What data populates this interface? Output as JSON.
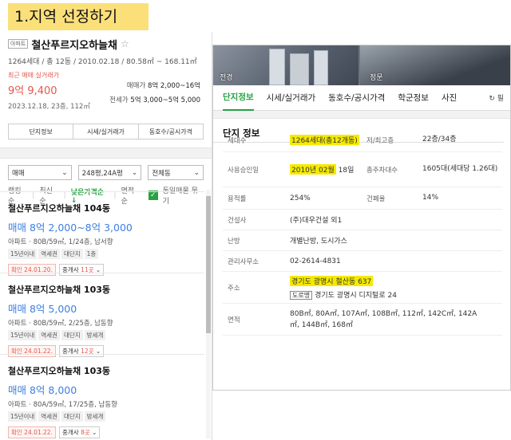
{
  "step_label": "1.지역 선정하기",
  "complex": {
    "badge": "아파트",
    "name": "철산푸르지오하늘채",
    "star": "☆",
    "meta": "1264세대 / 총 12동 / 2010.02.18 / 80.58㎡ ~ 168.11㎡",
    "recent_label": "최근 매매 실거래가",
    "recent_price": "9억 9,400",
    "recent_date": "2023.12.18, 23층, 112㎡",
    "sale_label": "매매가",
    "sale_range": "8억 2,000~16억",
    "jeonse_label": "전세가",
    "jeonse_range": "5억 3,000~5억 5,000"
  },
  "tab_buttons": [
    "단지정보",
    "시세/실거래가",
    "동호수/공시가격"
  ],
  "filters": {
    "deal": "매매",
    "area": "248평,24A평",
    "dong": "전체동"
  },
  "sort": {
    "options": [
      "랭킹순",
      "최신순",
      "낮은가격순↓",
      "면적순"
    ],
    "same_listing_label": "동일매물 묶기"
  },
  "listings": [
    {
      "name": "철산푸르지오하늘채 104동",
      "price": "매매 8억 2,000~8억 3,000",
      "spec": "아파트 · 80B/59㎡, 1/24층, 남서향",
      "tags": [
        "15년이내",
        "역세권",
        "대단지",
        "1층"
      ],
      "confirm": "확인 24.01.20.",
      "brokers_label": "중개사",
      "brokers_count": "11곳"
    },
    {
      "name": "철산푸르지오하늘채 103동",
      "price": "매매 8억 5,000",
      "spec": "아파트 · 80B/59㎡, 2/25층, 남동향",
      "tags": [
        "15년이내",
        "역세권",
        "대단지",
        "방세개"
      ],
      "confirm": "확인 24.01.22.",
      "brokers_label": "중개사",
      "brokers_count": "12곳"
    },
    {
      "name": "철산푸르지오하늘채 103동",
      "price": "매매 8억 8,000",
      "spec": "아파트 · 80A/59㎡, 17/25층, 남동향",
      "tags": [
        "15년이내",
        "역세권",
        "대단지",
        "방세개"
      ],
      "confirm": "확인 24.01.22.",
      "brokers_label": "중개사",
      "brokers_count": "8곳"
    }
  ],
  "photos": {
    "left_label": "전경",
    "right_label": "정문"
  },
  "right_tabs": [
    "단지정보",
    "시세/실거래가",
    "동호수/공시가격",
    "학군정보",
    "사진"
  ],
  "refresh_label": "↻ 필",
  "section_title": "단지 정보",
  "info": {
    "households_label": "세대수",
    "households_value": "1264세대(총12개동)",
    "floors_label": "저/최고층",
    "floors_value": "22층/34층",
    "approval_label": "사용승인일",
    "approval_value": "2010년 02월",
    "approval_day": "18일",
    "parking_label": "총주차대수",
    "parking_value": "1605대(세대당 1.26대)",
    "far_label": "용적률",
    "far_value": "254%",
    "bcr_label": "건폐율",
    "bcr_value": "14%",
    "builder_label": "건설사",
    "builder_value": "(주)대우건설 외1",
    "heating_label": "난방",
    "heating_value": "개별난방, 도시가스",
    "office_label": "관리사무소",
    "office_value": "02-2614-4831",
    "address_label": "주소",
    "address_value": "경기도 광명시 철산동 637",
    "road_badge": "도로명",
    "road_value": "경기도 광명시 디지털로 24",
    "area_label": "면적",
    "area_value": "80B㎡, 80A㎡, 107A㎡, 108B㎡, 112㎡, 142C㎡, 142A㎡, 144B㎡, 168㎡"
  },
  "colors": {
    "green": "#27a243",
    "blue_price": "#3d7fe0",
    "red": "#e4574a",
    "highlight": "#f5ea00"
  }
}
